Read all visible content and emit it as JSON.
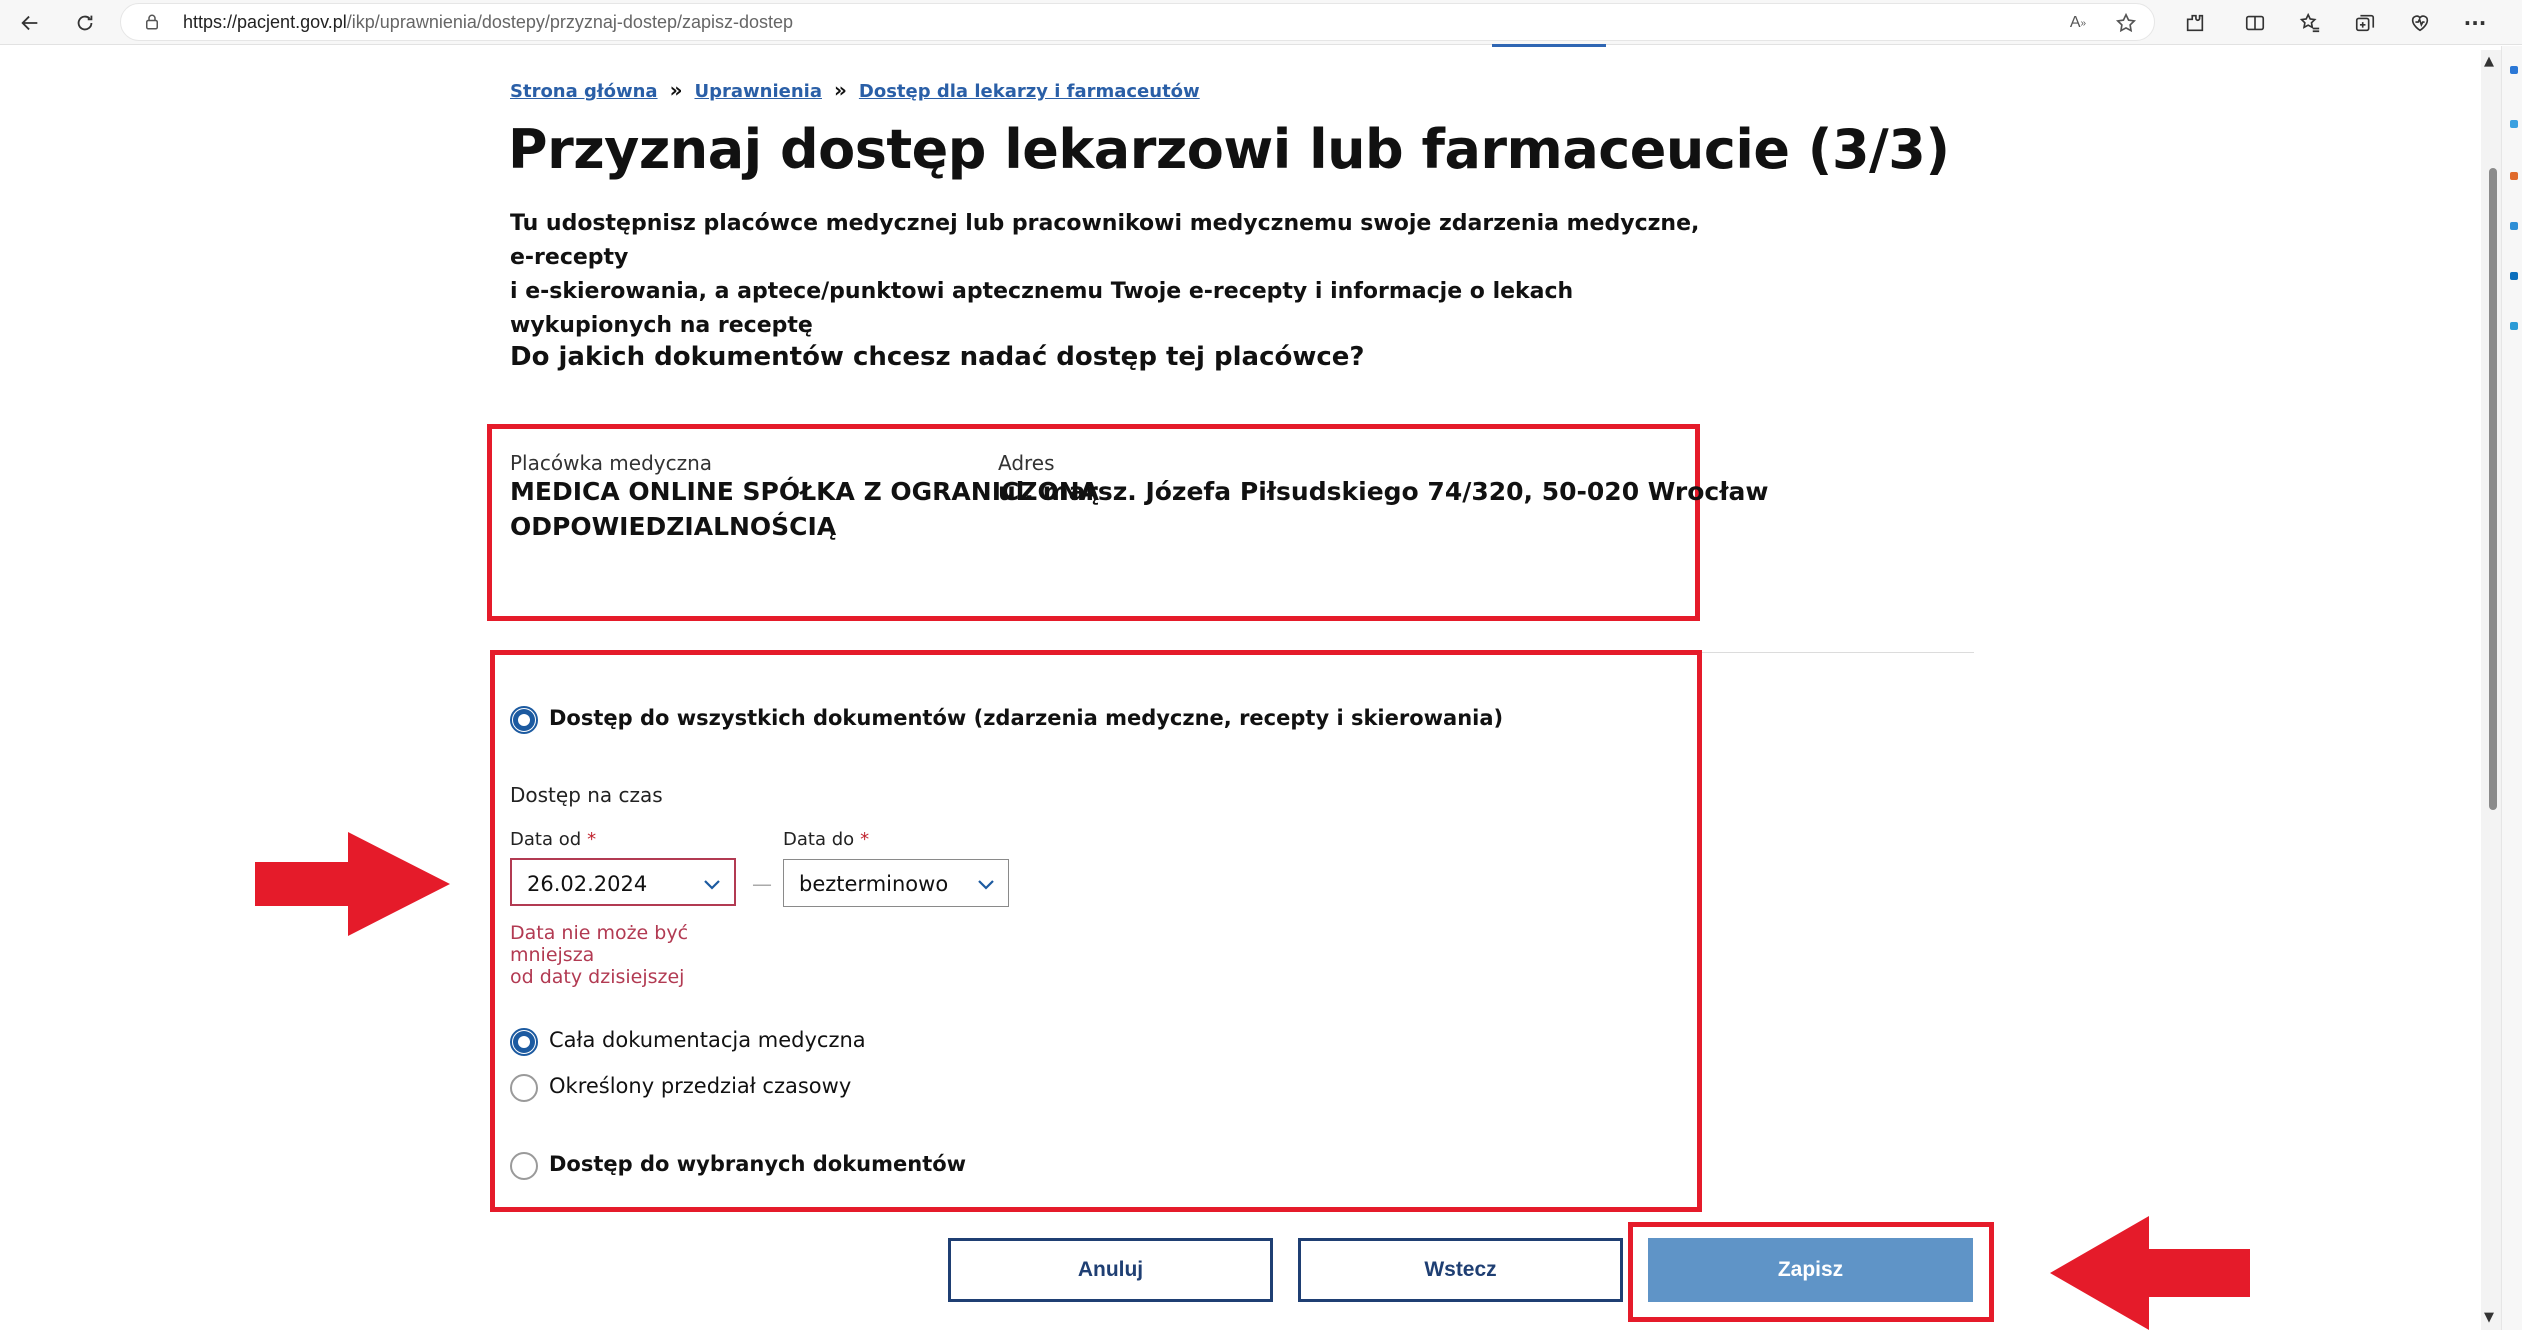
{
  "browser": {
    "url_host": "https://pacjent.gov.pl",
    "url_path": "/ikp/uprawnienia/dostepy/przyznaj-dostep/zapisz-dostep",
    "icons": [
      "back-icon",
      "refresh-icon",
      "lock-icon",
      "read-aloud-icon",
      "favorite-star-icon",
      "extensions-icon",
      "split-screen-icon",
      "favorites-icon",
      "collections-icon",
      "performance-icon",
      "more-icon"
    ],
    "more_label": "···"
  },
  "breadcrumb": {
    "items": [
      "Strona główna",
      "Uprawnienia",
      "Dostęp dla lekarzy i farmaceutów"
    ],
    "separator": "»"
  },
  "page": {
    "title": "Przyznaj dostęp lekarzowi lub farmaceucie (3/3)",
    "description_line1": "Tu udostępnisz placówce medycznej lub pracownikowi medycznemu swoje zdarzenia medyczne, e-recepty",
    "description_line2": "i e-skierowania, a aptece/punktowi aptecznemu Twoje e-recepty i informacje o lekach wykupionych na receptę",
    "question": "Do jakich dokumentów chcesz nadać dostęp tej placówce?"
  },
  "facility": {
    "name_label": "Placówka medyczna",
    "name_line1": "MEDICA ONLINE SPÓŁKA Z OGRANICZONĄ",
    "name_line2": "ODPOWIEDZIALNOŚCIĄ",
    "address_label": "Adres",
    "address_value": "ul. marsz. Józefa Piłsudskiego 74/320, 50-020 Wrocław"
  },
  "access": {
    "all_docs_label": "Dostęp do wszystkich dokumentów (zdarzenia medyczne, recepty i skierowania)",
    "all_docs_checked": true,
    "time_label": "Dostęp na czas",
    "date_from_label": "Data od",
    "date_from_value": "26.02.2024",
    "date_to_label": "Data do",
    "date_to_value": "bezterminowo",
    "required_mark": "*",
    "range_dash": "—",
    "error_line1": "Data nie może być",
    "error_line2": "mniejsza",
    "error_line3": "od daty dzisiejszej",
    "scope_all_label": "Cała dokumentacja medyczna",
    "scope_all_checked": true,
    "scope_period_label": "Określony przedział czasowy",
    "selected_docs_label": "Dostęp do wybranych dokumentów"
  },
  "buttons": {
    "cancel": "Anuluj",
    "back": "Wstecz",
    "save": "Zapisz"
  },
  "colors": {
    "highlight_red": "#e51b2a",
    "link_blue": "#2a5fa7",
    "primary_button": "#5f94c7",
    "error_text": "#b23a52"
  }
}
